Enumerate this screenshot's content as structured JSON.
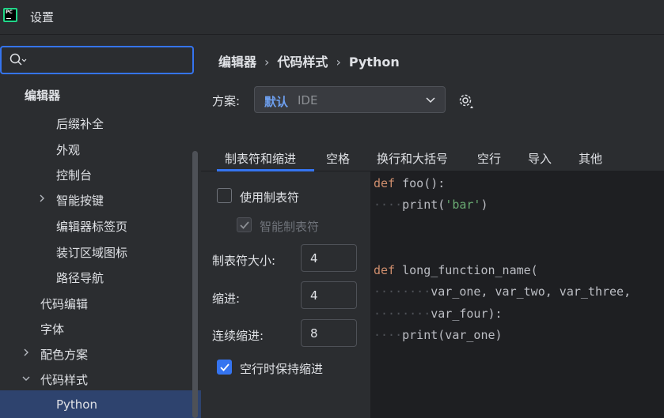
{
  "window": {
    "title": "设置",
    "logo_text": "PC"
  },
  "search": {
    "placeholder": "",
    "value": ""
  },
  "tree": {
    "root": "编辑器",
    "items": [
      "后缀补全",
      "外观",
      "控制台",
      "智能按键",
      "编辑器标签页",
      "装订区域图标",
      "路径导航",
      "代码编辑",
      "字体",
      "配色方案",
      "代码样式",
      "Python"
    ],
    "selected": "Python"
  },
  "breadcrumb": [
    "编辑器",
    "代码样式",
    "Python"
  ],
  "scheme": {
    "label": "方案:",
    "value": "默认",
    "sub": "IDE"
  },
  "tabs": [
    "制表符和缩进",
    "空格",
    "换行和大括号",
    "空行",
    "导入",
    "其他"
  ],
  "active_tab": "制表符和缩进",
  "options": {
    "use_tab": {
      "label": "使用制表符",
      "checked": false
    },
    "smart_tab": {
      "label": "智能制表符",
      "checked": true,
      "disabled": true
    },
    "tab_size": {
      "label": "制表符大小:",
      "value": "4"
    },
    "indent": {
      "label": "缩进:",
      "value": "4"
    },
    "continuation": {
      "label": "连续缩进:",
      "value": "8"
    },
    "keep_indent": {
      "label": "空行时保持缩进",
      "checked": true
    }
  },
  "code_preview": {
    "l1_kw": "def",
    "l1_rest": " foo():",
    "l2_dots": "····",
    "l2_fn": "print(",
    "l2_str": "'bar'",
    "l2_end": ")",
    "l5_kw": "def",
    "l5_rest": " long_function_name(",
    "l6_dots": "········",
    "l6_text": "var_one, var_two, var_three,",
    "l7_dots": "········",
    "l7_text": "var_four):",
    "l8_dots": "····",
    "l8_text": "print(var_one)"
  },
  "colors": {
    "accent": "#3574f0",
    "keyword": "#cf8e6d",
    "string": "#6aab73"
  }
}
